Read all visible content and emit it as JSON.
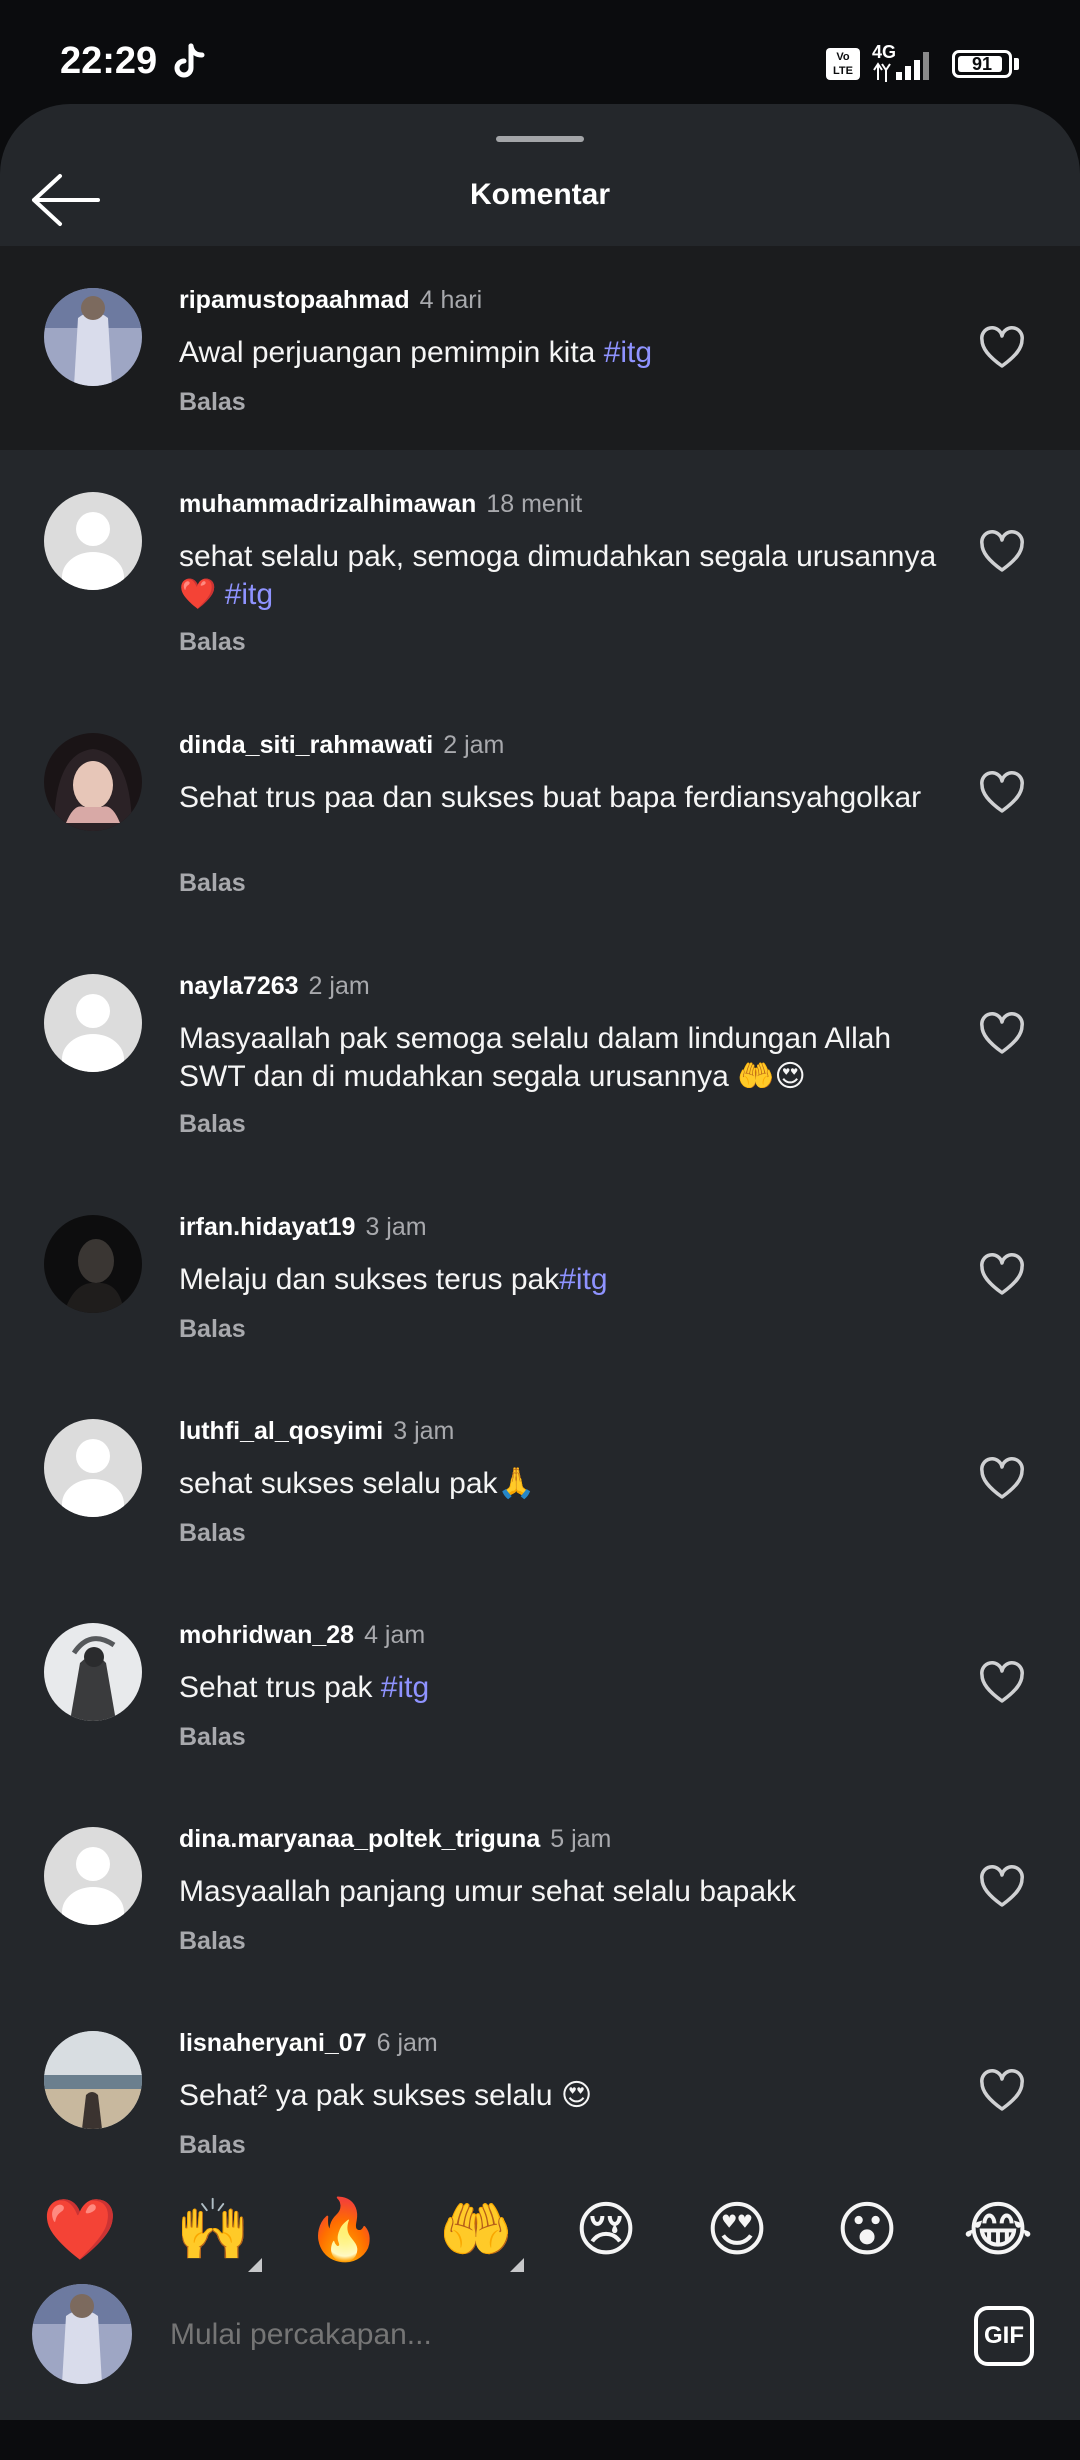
{
  "status_bar": {
    "time": "22:29",
    "volte_label": "Vo LTE",
    "network": "4G",
    "battery": "91",
    "battery_level": 0.91
  },
  "header": {
    "title": "Komentar"
  },
  "comments": [
    {
      "username": "ripamustopaahmad",
      "time": "4 hari",
      "text": "Awal perjuangan pemimpin kita ",
      "hashtag": "#itg",
      "reply": "Balas",
      "avatar": "photo-person-white-shirt"
    },
    {
      "username": "muhammadrizalhimawan",
      "time": "18 menit",
      "text": "sehat selalu pak, semoga dimudahkan segala urusannya❤️ ",
      "hashtag": "#itg",
      "reply": "Balas",
      "avatar": "default-avatar"
    },
    {
      "username": "dinda_siti_rahmawati",
      "time": "2 jam",
      "text": "Sehat trus paa dan sukses buat bapa ferdiansyahgolkar",
      "hashtag": "",
      "reply": "Balas",
      "avatar": "photo-woman-hijab"
    },
    {
      "username": "nayla7263",
      "time": "2 jam",
      "text": "Masyaallah pak semoga selalu dalam lindungan Allah SWT dan di mudahkan segala urusannya 🤲😍",
      "hashtag": "",
      "reply": "Balas",
      "avatar": "default-avatar"
    },
    {
      "username": "irfan.hidayat19",
      "time": "3 jam",
      "text": "Melaju dan sukses terus pak",
      "hashtag": "#itg",
      "reply": "Balas",
      "avatar": "photo-dark-portrait"
    },
    {
      "username": "luthfi_al_qosyimi",
      "time": "3 jam",
      "text": "sehat sukses selalu pak🙏",
      "hashtag": "",
      "reply": "Balas",
      "avatar": "default-avatar"
    },
    {
      "username": "mohridwan_28",
      "time": "4 jam",
      "text": "Sehat trus pak ",
      "hashtag": "#itg",
      "reply": "Balas",
      "avatar": "photo-silhouette"
    },
    {
      "username": "dina.maryanaa_poltek_triguna",
      "time": "5 jam",
      "text": "Masyaallah panjang umur sehat selalu bapakk",
      "hashtag": "",
      "reply": "Balas",
      "avatar": "default-avatar"
    },
    {
      "username": "lisnaheryani_07",
      "time": "6 jam",
      "text": "Sehat² ya pak sukses selalu 😍",
      "hashtag": "",
      "reply": "Balas",
      "avatar": "photo-beach"
    }
  ],
  "reactions": [
    "❤️",
    "🙌",
    "🔥",
    "🤲",
    "😢",
    "😍",
    "😮",
    "😂"
  ],
  "composer": {
    "placeholder": "Mulai percakapan...",
    "gif_label": "GIF"
  },
  "colors": {
    "background": "#24272b",
    "hashtag": "#8f93ff",
    "muted_text": "#a8a9ad"
  }
}
